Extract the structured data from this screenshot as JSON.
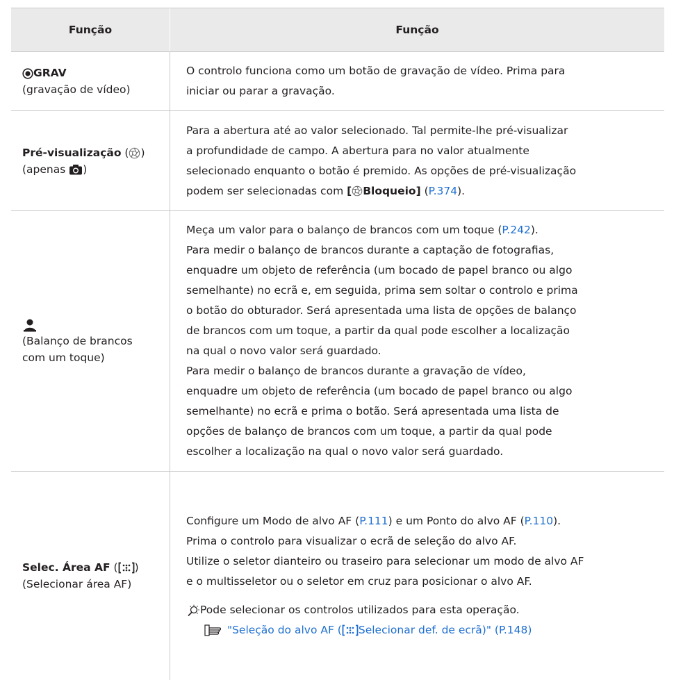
{
  "header": {
    "col1": "Função",
    "col2": "Função"
  },
  "rows": [
    {
      "name_bold": "GRAV",
      "name_sub": "(gravação de vídeo)",
      "desc": [
        "O controlo funciona como um botão de gravação de vídeo. Prima para",
        "iniciar ou parar a gravação."
      ]
    },
    {
      "name_bold": "Pré-visualização",
      "name_open": " (",
      "name_close": ")",
      "name_sub_a": "(apenas ",
      "name_sub_b": ")",
      "desc": [
        "Para a abertura até ao valor selecionado. Tal permite-lhe pré-visualizar",
        "a profundidade de campo. A abertura para no valor atualmente",
        "selecionado enquanto o botão é premido. As opções de pré-visualização"
      ],
      "desc_last_a": "podem ser selecionadas com ",
      "desc_last_bracket_open": "[",
      "desc_last_bold": "Bloqueio]",
      "desc_last_open": " (",
      "desc_last_link": "P.374",
      "desc_last_close": ")."
    },
    {
      "name_sub1": "(Balanço de brancos",
      "name_sub2": "com um toque)",
      "desc_first_a": "Meça um valor para o balanço de brancos com um toque (",
      "desc_first_link": "P.242",
      "desc_first_b": ").",
      "desc": [
        "Para medir o balanço de brancos durante a captação de fotografias,",
        "enquadre um objeto de referência (um bocado de papel branco ou algo",
        "semelhante) no ecrã e, em seguida, prima sem soltar o controlo e prima",
        "o botão do obturador. Será apresentada uma lista de opções de balanço",
        "de brancos com um toque, a partir da qual pode escolher a localização",
        "na qual o novo valor será guardado.",
        "Para medir o balanço de brancos durante a gravação de vídeo,",
        "enquadre um objeto de referência (um bocado de papel branco ou algo",
        "semelhante) no ecrã e prima o botão. Será apresentada uma lista de",
        "opções de balanço de brancos com um toque, a partir da qual pode",
        "escolher a localização na qual o novo valor será guardado."
      ]
    },
    {
      "name_bold": "Selec. Área AF",
      "name_open": " (",
      "name_close": ")",
      "name_sub": "(Selecionar área AF)",
      "desc_first_a": "Configure um Modo de alvo AF (",
      "desc_first_link1": "P.111",
      "desc_first_b": ") e um Ponto do alvo AF (",
      "desc_first_link2": "P.110",
      "desc_first_c": ").",
      "desc": [
        "Prima o controlo para visualizar o ecrã de seleção do alvo AF.",
        "Utilize o seletor dianteiro ou traseiro para selecionar um modo de alvo AF",
        "e o multisseletor ou o seletor em cruz para posicionar o alvo AF."
      ],
      "tip": "Pode selecionar os controlos utilizados para esta operação.",
      "ref_a": "\"Seleção do alvo AF (",
      "ref_b": "Selecionar def. de ecrã)\" (P.148)"
    }
  ]
}
